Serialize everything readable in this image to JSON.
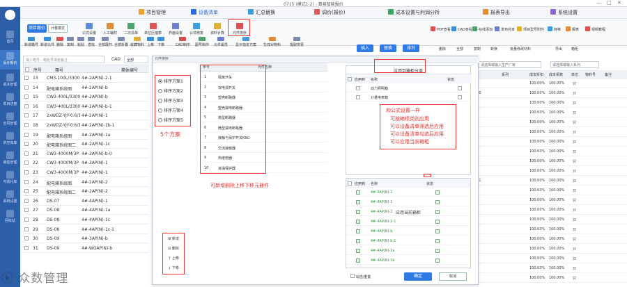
{
  "window": {
    "title": "0715 (模式1-2) - 算易智能报价",
    "min": "—",
    "max": "□",
    "close": "✕"
  },
  "leftnav": [
    {
      "label": "首页"
    },
    {
      "label": "设计报价"
    },
    {
      "label": "成本管理"
    },
    {
      "label": "项目进度"
    },
    {
      "label": "合同管理"
    },
    {
      "label": "供应商库"
    },
    {
      "label": "销售管理"
    },
    {
      "label": "可视化库"
    },
    {
      "label": "系统设置"
    },
    {
      "label": "回收站"
    }
  ],
  "menu": [
    {
      "label": "项目管理"
    },
    {
      "label": "设备清单"
    },
    {
      "label": "汇总替换"
    },
    {
      "label": "调价(报价)"
    },
    {
      "label": "成本设置与利润分析"
    },
    {
      "label": "报表导出"
    },
    {
      "label": "系统设置"
    }
  ],
  "ribbon": {
    "left_buttons": [
      {
        "label": "项目跟价"
      },
      {
        "label": "计量模式"
      }
    ],
    "tools_row1": [
      {
        "label": "公式设置"
      },
      {
        "label": "人工辅材"
      },
      {
        "label": "二次清单"
      },
      {
        "label": "单位压缩表"
      },
      {
        "label": "界面设置"
      },
      {
        "label": "公式修复"
      },
      {
        "label": "资料计算"
      },
      {
        "label": "元件排序"
      }
    ],
    "tools_row2": [
      {
        "label": "新增箱号"
      },
      {
        "label": "新增元件"
      },
      {
        "label": "删除"
      },
      {
        "label": "复制"
      },
      {
        "label": "粘贴"
      },
      {
        "label": "查找"
      },
      {
        "label": "全部展开"
      },
      {
        "label": "全部折叠"
      },
      {
        "label": "收藏物料"
      },
      {
        "label": "上移"
      },
      {
        "label": "下移"
      },
      {
        "label": "CAD制作"
      },
      {
        "label": "图号制作"
      },
      {
        "label": "元件属性"
      },
      {
        "label": "显示指定方案"
      },
      {
        "label": "生成对物料"
      },
      {
        "label": "提取变更"
      }
    ],
    "right_tools": [
      {
        "label": "PDF查看"
      },
      {
        "label": "CAD查看"
      },
      {
        "label": "在线添加"
      },
      {
        "label": "发布共享"
      },
      {
        "label": "项目型号附件"
      },
      {
        "label": "转移"
      },
      {
        "label": "报表"
      },
      {
        "label": "视频教程"
      }
    ],
    "right_tabs": [
      {
        "label": "插入"
      },
      {
        "label": "替换"
      },
      {
        "label": "排列"
      }
    ],
    "right_actions": [
      {
        "label": "删除"
      },
      {
        "label": "全部"
      },
      {
        "label": "复制"
      },
      {
        "label": "转换"
      },
      {
        "label": "批量修改材料"
      },
      {
        "label": "导出"
      },
      {
        "label": "箱柜"
      }
    ]
  },
  "search": {
    "placeholder": "输入箱号、箱柜号或者备注",
    "cad_label": "CAD",
    "cad_value": "全部"
  },
  "grid": {
    "headers": [
      "序号",
      "箱号",
      "箱体编号"
    ],
    "rows": [
      {
        "no": "13",
        "code": "CM3-100L/3300",
        "id": "4#-2AP(N)-2-1"
      },
      {
        "no": "14",
        "code": "配电箱系统图",
        "id": "4#-2AP(N)-b"
      },
      {
        "no": "15",
        "code": "CW3-400L/3300",
        "id": "4#-2AP(N)-b"
      },
      {
        "no": "16",
        "code": "CW3-400L/3300",
        "id": "4#-2AP(N)-b-1"
      },
      {
        "no": "17",
        "code": "2xWDZ-YJY-0.6/1",
        "id": "4#-2AP(N)-1"
      },
      {
        "no": "18",
        "code": "2xWDZ-YJY-0.6/1",
        "id": "4#-2AP(N)-1b-1"
      },
      {
        "no": "19",
        "code": "配电箱系统图",
        "id": "4#-2AP(N)-1a"
      },
      {
        "no": "20",
        "code": "配电箱系统图二",
        "id": "4#-2AP(N)-1c"
      },
      {
        "no": "21",
        "code": "CW3-4000M/3P",
        "id": "4#-3AP(N)-b-0"
      },
      {
        "no": "22",
        "code": "CW3-4000M/3P",
        "id": "4#-3AP(N)-1"
      },
      {
        "no": "23",
        "code": "CW3-4000M/3P",
        "id": "4#-2AP(N)-1"
      },
      {
        "no": "24",
        "code": "配电箱系统图",
        "id": "4#-2AP(N)-2"
      },
      {
        "no": "25",
        "code": "配电箱系统图二",
        "id": "4#-2AP(N)-2"
      },
      {
        "no": "26",
        "code": "DS-07",
        "id": "4#-4AP(N)-1"
      },
      {
        "no": "27",
        "code": "DS-08",
        "id": "4#-4AP(N)-1a"
      },
      {
        "no": "28",
        "code": "DS-08",
        "id": "4#-4AP(N)-1c"
      },
      {
        "no": "29",
        "code": "DS-08",
        "id": "4#-4AP(N)-1c-1"
      },
      {
        "no": "30",
        "code": "DS-09",
        "id": "4#-3AP(N)-b"
      },
      {
        "no": "31",
        "code": "DS-09",
        "id": "4#-WOAP(N)-b"
      }
    ]
  },
  "dialog": {
    "title": "元件排序",
    "col_no": "序号",
    "col_name": "元件名称",
    "schemes": [
      "排序方案1",
      "排序方案2",
      "排序方案3",
      "排序方案4",
      "排序方案5"
    ],
    "components": [
      {
        "no": "1",
        "name": "隔离开关"
      },
      {
        "no": "2",
        "name": "双电源开关"
      },
      {
        "no": "3",
        "name": "塑壳断路器"
      },
      {
        "no": "4",
        "name": "塑壳漏电断路器"
      },
      {
        "no": "5",
        "name": "微型断路器"
      },
      {
        "no": "6",
        "name": "微型漏电断路器"
      },
      {
        "no": "7",
        "name": "接触与保护开关KBO"
      },
      {
        "no": "8",
        "name": "交流接触器"
      },
      {
        "no": "9",
        "name": "热继电器"
      },
      {
        "no": "10",
        "name": "浪涌保护器"
      }
    ],
    "side_buttons": [
      {
        "label": "新增"
      },
      {
        "label": "删除"
      },
      {
        "label": "上移"
      },
      {
        "label": "下移"
      }
    ],
    "apply_panel_title": "应用到箱柜分类",
    "apply_col1": "应用到",
    "apply_col2": "名称",
    "apply_col3": "状态",
    "apply_items": [
      {
        "name": "动力照明箱"
      },
      {
        "name": "计量电表箱"
      }
    ],
    "current_panel_title": "应用当前箱柜",
    "current_col1": "应用到",
    "current_col2": "名称",
    "current_col3": "状态",
    "current_items": [
      "4#-3AP(N)-2",
      "4#-4AP(N)-1",
      "4#-4AP(N)-2",
      "4#-4AP(N)-2-1",
      "4#-4AP(N)-b",
      "4#-4AP(N)-b-1",
      "4#-4AP(N)-1a",
      "4#-4AP(N)-1b"
    ],
    "check_all": "勾选/重置",
    "ok": "确定",
    "cancel": "取消"
  },
  "annotations": {
    "schemes": "5个方案",
    "components": "可新增删除上移下移元器件",
    "apply": [
      "和公式设置一样",
      "可按箱柜类别应用",
      "可以设备清单筛选后应用",
      "可以设备清单勾选后应用",
      "可以应用当前箱柜"
    ]
  },
  "right": {
    "filter1": "请选择或输入生产厂家",
    "filter2": "请选择或输入系列",
    "headers": [
      "单价",
      "系列",
      "成本折扣",
      "成本系数",
      "单位",
      "物料号",
      "备注"
    ],
    "rows": [
      [
        "59.22",
        "100.00%",
        "100.00%",
        "只"
      ],
      [
        "387.00",
        "100.00%",
        "100.00%",
        "只"
      ],
      [
        "22.00",
        "100.00%",
        "100.00%",
        "只"
      ],
      [
        "53.42",
        "100.00%",
        "100.00%",
        "只"
      ],
      [
        "53.17",
        "100.00%",
        "100.00%",
        "只"
      ],
      [
        "45.44",
        "100.00%",
        "100.00%",
        "只"
      ],
      [
        "24.91",
        "100.00%",
        "100.00%",
        "只"
      ],
      [
        "35.79",
        "100.00%",
        "100.00%",
        "只"
      ],
      [
        "25.74",
        "100.00%",
        "100.00%",
        "只"
      ],
      [
        "25.30",
        "100.00%",
        "100.00%",
        "只"
      ],
      [
        "121.91",
        "100.00%",
        "100.00%",
        "只"
      ],
      [
        "55.52",
        "100.00%",
        "100.00%",
        "只"
      ],
      [
        "35.55",
        "100.00%",
        "100.00%",
        "只"
      ],
      [
        "58.84",
        "100.00%",
        "100.00%",
        "只"
      ],
      [
        "44.34",
        "100.00%",
        "100.00%",
        "只"
      ],
      [
        "35.74",
        "100.00%",
        "100.00%",
        "只"
      ],
      [
        "22.57",
        "100.00%",
        "100.00%",
        "只"
      ],
      [
        "25.30",
        "100.00%",
        "100.00%",
        "只"
      ],
      [
        "25.74",
        "100.00%",
        "100.00%",
        "只"
      ],
      [
        "22.00",
        "100.00%",
        "100.00%",
        "只"
      ],
      [
        "16.45",
        "100.00%",
        "100.00%",
        "只"
      ]
    ]
  },
  "watermark": "ⓚ 众数管理"
}
